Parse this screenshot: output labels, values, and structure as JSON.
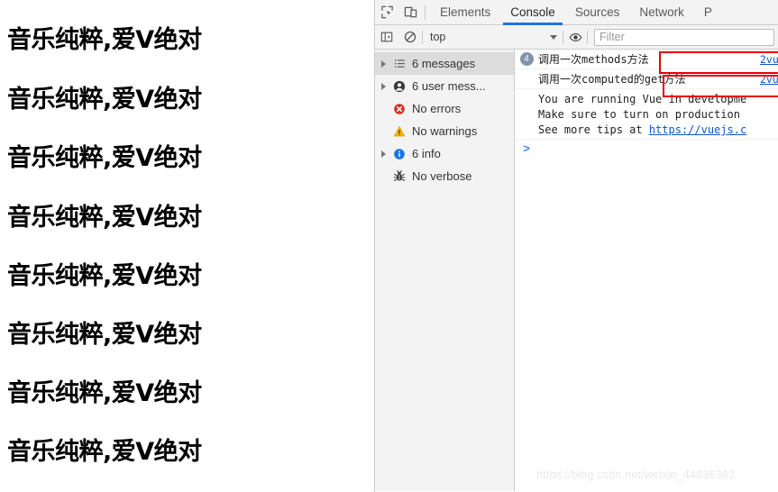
{
  "webpage": {
    "lines": [
      "音乐纯粹,爱V绝对",
      "音乐纯粹,爱V绝对",
      "音乐纯粹,爱V绝对",
      "音乐纯粹,爱V绝对",
      "音乐纯粹,爱V绝对",
      "音乐纯粹,爱V绝对",
      "音乐纯粹,爱V绝对",
      "音乐纯粹,爱V绝对"
    ]
  },
  "devtools": {
    "tabs": [
      {
        "label": "Elements",
        "active": false
      },
      {
        "label": "Console",
        "active": true
      },
      {
        "label": "Sources",
        "active": false
      },
      {
        "label": "Network",
        "active": false
      },
      {
        "label": "P",
        "active": false
      }
    ],
    "toolbar": {
      "inspect_icon": "inspect-element-icon",
      "device_icon": "device-toolbar-icon",
      "sidebar_toggle_icon": "console-sidebar-toggle-icon",
      "clear_icon": "clear-console-icon",
      "eye_icon": "live-expression-eye-icon",
      "context_value": "top",
      "filter_placeholder": "Filter",
      "filter_value": ""
    },
    "sidebar": {
      "rows": [
        {
          "label": "6 messages",
          "icon": "list-icon",
          "expandable": true,
          "selected": true
        },
        {
          "label": "6 user mess...",
          "icon": "user-icon",
          "expandable": true,
          "selected": false
        },
        {
          "label": "No errors",
          "icon": "error-icon",
          "expandable": false,
          "selected": false
        },
        {
          "label": "No warnings",
          "icon": "warning-icon",
          "expandable": false,
          "selected": false
        },
        {
          "label": "6 info",
          "icon": "info-icon",
          "expandable": true,
          "selected": false
        },
        {
          "label": "No verbose",
          "icon": "verbose-bug-icon",
          "expandable": false,
          "selected": false
        }
      ]
    },
    "messages": [
      {
        "badge": "4",
        "text": "调用一次methods方法",
        "source": "2vu"
      },
      {
        "badge": "",
        "text": "调用一次computed的get方法",
        "source": "2vu"
      }
    ],
    "info_message": {
      "line1": "You are running Vue in developme",
      "line2": "Make sure to turn on production",
      "line3_prefix": "See more tips at ",
      "line3_link": "https://vuejs.c"
    },
    "prompt_caret": ">"
  },
  "watermark": "https://blog.csdn.net/weixin_44836362",
  "colors": {
    "accent_blue": "#1a73e8",
    "annotation_red": "#e60000",
    "link_blue": "#1155cc",
    "badge_grey_blue": "#8293a8",
    "error_red": "#d93025",
    "warning_yellow": "#f5b400",
    "info_blue": "#1a73e8"
  }
}
